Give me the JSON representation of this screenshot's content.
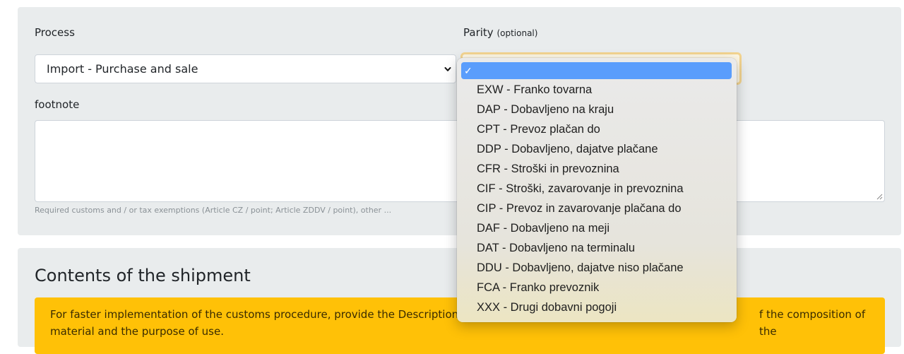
{
  "form": {
    "process_label": "Process",
    "process_value": "Import - Purchase and sale",
    "parity_label": "Parity",
    "parity_optional": "(optional)",
    "footnote_label": "footnote",
    "footnote_value": "",
    "footnote_hint": "Required customs and / or tax exemptions (Article CZ / point; Article ZDDV / point), other ..."
  },
  "shipment": {
    "title": "Contents of the shipment",
    "alert_line1_start": "For faster implementation of the customs procedure, provide the Description o",
    "alert_line1_end": "f the composition of the",
    "alert_line2": "material and the purpose of use."
  },
  "parity_dropdown": {
    "selected_mark": "✓",
    "options": [
      "EXW - Franko tovarna",
      "DAP - Dobavljeno na kraju",
      "CPT - Prevoz plačan do",
      "DDP - Dobavljeno, dajatve plačane",
      "CFR - Stroški in prevoznina",
      "CIF - Stroški, zavarovanje in prevoznina",
      "CIP - Prevoz in zavarovanje plačana do",
      "DAF - Dobavljeno na meji",
      "DAT - Dobavljeno na terminalu",
      "DDU - Dobavljeno, dajatve niso plačane",
      "FCA - Franko prevoznik",
      "XXX - Drugi dobavni pogoji"
    ]
  },
  "colors": {
    "panel_bg": "#e9eced",
    "alert_bg": "#ffc107",
    "selected_option_bg": "#5a9dfc"
  }
}
